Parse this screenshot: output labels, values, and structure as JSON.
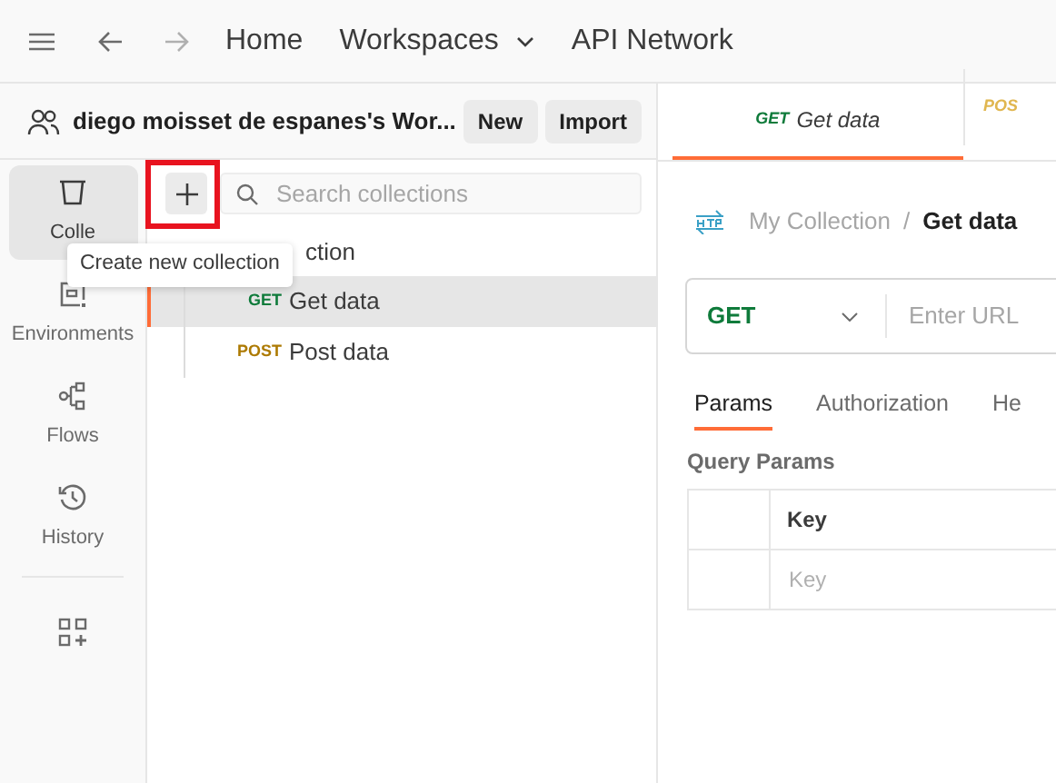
{
  "top_nav": {
    "items": [
      {
        "label": "Home",
        "dropdown": false
      },
      {
        "label": "Workspaces",
        "dropdown": true
      },
      {
        "label": "API Network",
        "dropdown": false
      }
    ]
  },
  "workspace": {
    "name": "diego moisset de espanes's Wor...",
    "buttons": [
      "New",
      "Import"
    ]
  },
  "sidebar": {
    "items": [
      {
        "label": "Colle",
        "selected": true
      },
      {
        "label": "Environments",
        "selected": false
      },
      {
        "label": "Flows",
        "selected": false
      },
      {
        "label": "History",
        "selected": false
      }
    ]
  },
  "collections": {
    "search": {
      "placeholder": "Search collections"
    },
    "tooltip": "Create new collection",
    "tree": [
      {
        "label": "ction",
        "children": [
          {
            "method": "GET",
            "label": "Get data",
            "selected": true
          },
          {
            "method": "POST",
            "label": "Post data",
            "selected": false
          }
        ]
      }
    ]
  },
  "tabs": [
    {
      "method": "GET",
      "label": "Get data",
      "selected": true
    },
    {
      "method": "POS",
      "selected": false
    }
  ],
  "breadcrumb": {
    "parent": "My Collection",
    "separator": "/",
    "current": "Get data"
  },
  "request": {
    "method": "GET",
    "url_placeholder": "Enter URL"
  },
  "request_tabs": [
    {
      "label": "Params",
      "selected": true
    },
    {
      "label": "Authorization",
      "selected": false
    },
    {
      "label": "He",
      "selected": false
    }
  ],
  "query_params": {
    "title": "Query Params",
    "header": "Key",
    "placeholder": "Key"
  }
}
